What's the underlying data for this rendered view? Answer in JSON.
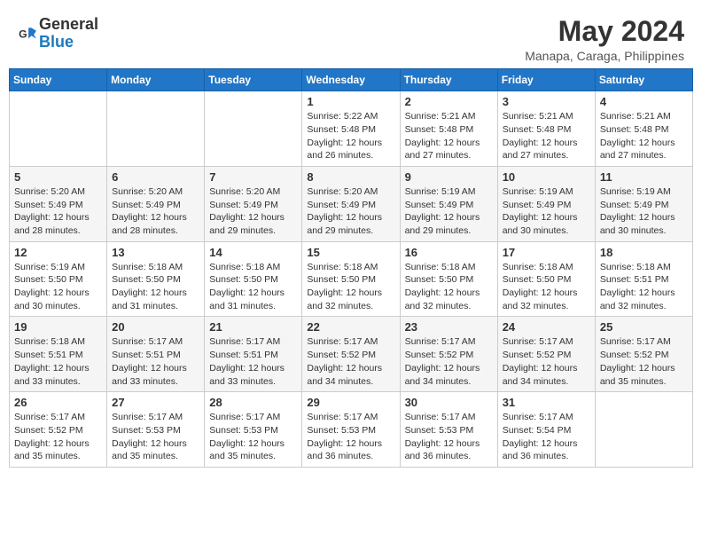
{
  "logo": {
    "text_general": "General",
    "text_blue": "Blue"
  },
  "header": {
    "title": "May 2024",
    "subtitle": "Manapa, Caraga, Philippines"
  },
  "weekdays": [
    "Sunday",
    "Monday",
    "Tuesday",
    "Wednesday",
    "Thursday",
    "Friday",
    "Saturday"
  ],
  "weeks": [
    [
      {
        "day": "",
        "info": ""
      },
      {
        "day": "",
        "info": ""
      },
      {
        "day": "",
        "info": ""
      },
      {
        "day": "1",
        "info": "Sunrise: 5:22 AM\nSunset: 5:48 PM\nDaylight: 12 hours and 26 minutes."
      },
      {
        "day": "2",
        "info": "Sunrise: 5:21 AM\nSunset: 5:48 PM\nDaylight: 12 hours and 27 minutes."
      },
      {
        "day": "3",
        "info": "Sunrise: 5:21 AM\nSunset: 5:48 PM\nDaylight: 12 hours and 27 minutes."
      },
      {
        "day": "4",
        "info": "Sunrise: 5:21 AM\nSunset: 5:48 PM\nDaylight: 12 hours and 27 minutes."
      }
    ],
    [
      {
        "day": "5",
        "info": "Sunrise: 5:20 AM\nSunset: 5:49 PM\nDaylight: 12 hours and 28 minutes."
      },
      {
        "day": "6",
        "info": "Sunrise: 5:20 AM\nSunset: 5:49 PM\nDaylight: 12 hours and 28 minutes."
      },
      {
        "day": "7",
        "info": "Sunrise: 5:20 AM\nSunset: 5:49 PM\nDaylight: 12 hours and 29 minutes."
      },
      {
        "day": "8",
        "info": "Sunrise: 5:20 AM\nSunset: 5:49 PM\nDaylight: 12 hours and 29 minutes."
      },
      {
        "day": "9",
        "info": "Sunrise: 5:19 AM\nSunset: 5:49 PM\nDaylight: 12 hours and 29 minutes."
      },
      {
        "day": "10",
        "info": "Sunrise: 5:19 AM\nSunset: 5:49 PM\nDaylight: 12 hours and 30 minutes."
      },
      {
        "day": "11",
        "info": "Sunrise: 5:19 AM\nSunset: 5:49 PM\nDaylight: 12 hours and 30 minutes."
      }
    ],
    [
      {
        "day": "12",
        "info": "Sunrise: 5:19 AM\nSunset: 5:50 PM\nDaylight: 12 hours and 30 minutes."
      },
      {
        "day": "13",
        "info": "Sunrise: 5:18 AM\nSunset: 5:50 PM\nDaylight: 12 hours and 31 minutes."
      },
      {
        "day": "14",
        "info": "Sunrise: 5:18 AM\nSunset: 5:50 PM\nDaylight: 12 hours and 31 minutes."
      },
      {
        "day": "15",
        "info": "Sunrise: 5:18 AM\nSunset: 5:50 PM\nDaylight: 12 hours and 32 minutes."
      },
      {
        "day": "16",
        "info": "Sunrise: 5:18 AM\nSunset: 5:50 PM\nDaylight: 12 hours and 32 minutes."
      },
      {
        "day": "17",
        "info": "Sunrise: 5:18 AM\nSunset: 5:50 PM\nDaylight: 12 hours and 32 minutes."
      },
      {
        "day": "18",
        "info": "Sunrise: 5:18 AM\nSunset: 5:51 PM\nDaylight: 12 hours and 32 minutes."
      }
    ],
    [
      {
        "day": "19",
        "info": "Sunrise: 5:18 AM\nSunset: 5:51 PM\nDaylight: 12 hours and 33 minutes."
      },
      {
        "day": "20",
        "info": "Sunrise: 5:17 AM\nSunset: 5:51 PM\nDaylight: 12 hours and 33 minutes."
      },
      {
        "day": "21",
        "info": "Sunrise: 5:17 AM\nSunset: 5:51 PM\nDaylight: 12 hours and 33 minutes."
      },
      {
        "day": "22",
        "info": "Sunrise: 5:17 AM\nSunset: 5:52 PM\nDaylight: 12 hours and 34 minutes."
      },
      {
        "day": "23",
        "info": "Sunrise: 5:17 AM\nSunset: 5:52 PM\nDaylight: 12 hours and 34 minutes."
      },
      {
        "day": "24",
        "info": "Sunrise: 5:17 AM\nSunset: 5:52 PM\nDaylight: 12 hours and 34 minutes."
      },
      {
        "day": "25",
        "info": "Sunrise: 5:17 AM\nSunset: 5:52 PM\nDaylight: 12 hours and 35 minutes."
      }
    ],
    [
      {
        "day": "26",
        "info": "Sunrise: 5:17 AM\nSunset: 5:52 PM\nDaylight: 12 hours and 35 minutes."
      },
      {
        "day": "27",
        "info": "Sunrise: 5:17 AM\nSunset: 5:53 PM\nDaylight: 12 hours and 35 minutes."
      },
      {
        "day": "28",
        "info": "Sunrise: 5:17 AM\nSunset: 5:53 PM\nDaylight: 12 hours and 35 minutes."
      },
      {
        "day": "29",
        "info": "Sunrise: 5:17 AM\nSunset: 5:53 PM\nDaylight: 12 hours and 36 minutes."
      },
      {
        "day": "30",
        "info": "Sunrise: 5:17 AM\nSunset: 5:53 PM\nDaylight: 12 hours and 36 minutes."
      },
      {
        "day": "31",
        "info": "Sunrise: 5:17 AM\nSunset: 5:54 PM\nDaylight: 12 hours and 36 minutes."
      },
      {
        "day": "",
        "info": ""
      }
    ]
  ]
}
